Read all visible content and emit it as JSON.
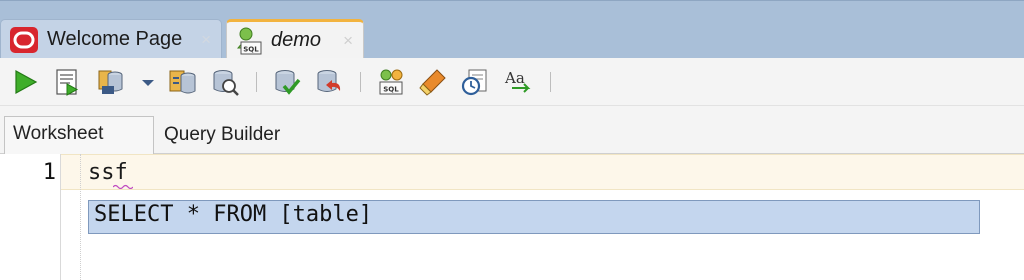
{
  "tabs": [
    {
      "label": "Welcome Page",
      "icon": "oracle-logo-icon",
      "active": false
    },
    {
      "label": "demo",
      "icon": "sql-worksheet-icon",
      "active": true
    }
  ],
  "close_glyph": "×",
  "toolbar": {
    "buttons": [
      {
        "name": "run-statement-button",
        "icon": "play-icon"
      },
      {
        "name": "run-script-button",
        "icon": "script-icon"
      },
      {
        "name": "commit-button",
        "icon": "database-commit-icon"
      },
      {
        "name": "dropdown-button",
        "icon": "chevron-down-icon"
      },
      {
        "name": "explain-plan-button",
        "icon": "explain-plan-icon"
      },
      {
        "name": "autotrace-button",
        "icon": "autotrace-icon"
      },
      {
        "name": "commit-transaction-button",
        "icon": "commit-check-icon"
      },
      {
        "name": "rollback-button",
        "icon": "rollback-icon"
      },
      {
        "name": "sql-tuning-button",
        "icon": "sql-gear-icon"
      },
      {
        "name": "clear-button",
        "icon": "eraser-icon"
      },
      {
        "name": "sql-history-button",
        "icon": "history-clock-icon"
      },
      {
        "name": "change-case-button",
        "icon": "text-case-icon"
      }
    ]
  },
  "subtabs": {
    "worksheet": "Worksheet",
    "query_builder": "Query Builder"
  },
  "editor": {
    "line_number": "1",
    "code": "ssf",
    "suggestion": "SELECT * FROM [table]"
  },
  "colors": {
    "tab_bar": "#a9bfd8",
    "active_tab_accent": "#f2b33f",
    "current_line": "#fdf7ea",
    "suggestion_bg": "#c4d6ee",
    "suggestion_border": "#7f99bd"
  }
}
